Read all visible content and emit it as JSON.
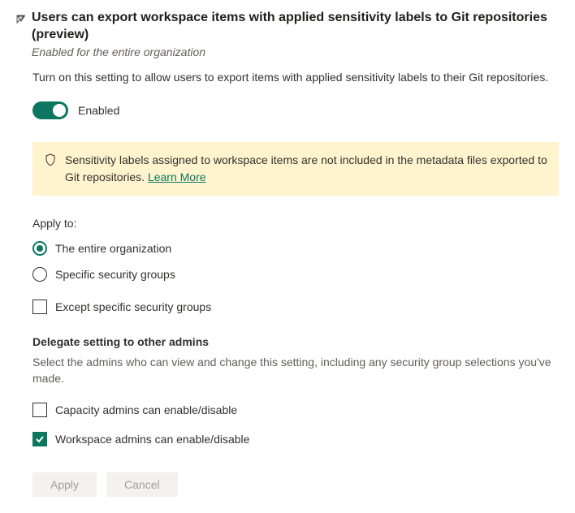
{
  "header": {
    "title": "Users can export workspace items with applied sensitivity labels to Git repositories (preview)",
    "subtitle": "Enabled for the entire organization"
  },
  "description": "Turn on this setting to allow users to export items with applied sensitivity labels to their Git repositories.",
  "toggle": {
    "label": "Enabled"
  },
  "banner": {
    "text": "Sensitivity labels assigned to workspace items are not included in the metadata files exported to Git repositories. ",
    "link": "Learn More"
  },
  "apply": {
    "label": "Apply to:",
    "option_entire": "The entire organization",
    "option_specific": "Specific security groups",
    "except": "Except specific security groups"
  },
  "delegate": {
    "heading": "Delegate setting to other admins",
    "description": "Select the admins who can view and change this setting, including any security group selections you've made.",
    "capacity": "Capacity admins can enable/disable",
    "workspace": "Workspace admins can enable/disable"
  },
  "buttons": {
    "apply": "Apply",
    "cancel": "Cancel"
  }
}
